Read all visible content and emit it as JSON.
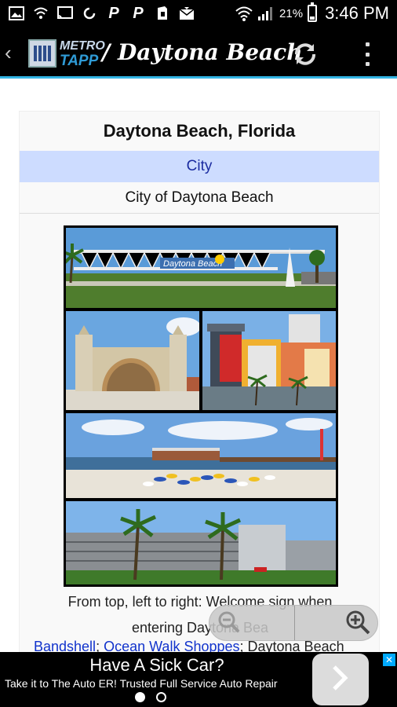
{
  "status_bar": {
    "battery_pct": "21%",
    "time": "3:46 PM",
    "icons": [
      "image-icon",
      "wifi-icon",
      "cast-icon",
      "sync-icon",
      "paypal-icon",
      "paypal-icon",
      "shield-icon",
      "mail-icon",
      "wifi-signal-icon",
      "cell-signal-icon",
      "battery-icon"
    ]
  },
  "action_bar": {
    "logo_line1": "METRO",
    "logo_line2": "TAPP",
    "title": "/ Daytona Beach"
  },
  "infobox": {
    "title": "Daytona Beach, Florida",
    "type": "City",
    "name": "City of Daytona Beach"
  },
  "caption": {
    "line1": "From top, left to right: Welcome sign when",
    "line2": "entering Daytona Bea",
    "link1": "Bandshell",
    "sep": "; ",
    "link2": "Ocean Walk Shoppes",
    "tail": "; Daytona Beach"
  },
  "ad": {
    "title": "Have A Sick Car?",
    "subtitle": "Take it to The Auto ER! Trusted Full Service Auto Repair"
  },
  "colors": {
    "accent": "#33b5e5",
    "type_row_bg": "#cddcff",
    "link": "#1133cc"
  }
}
